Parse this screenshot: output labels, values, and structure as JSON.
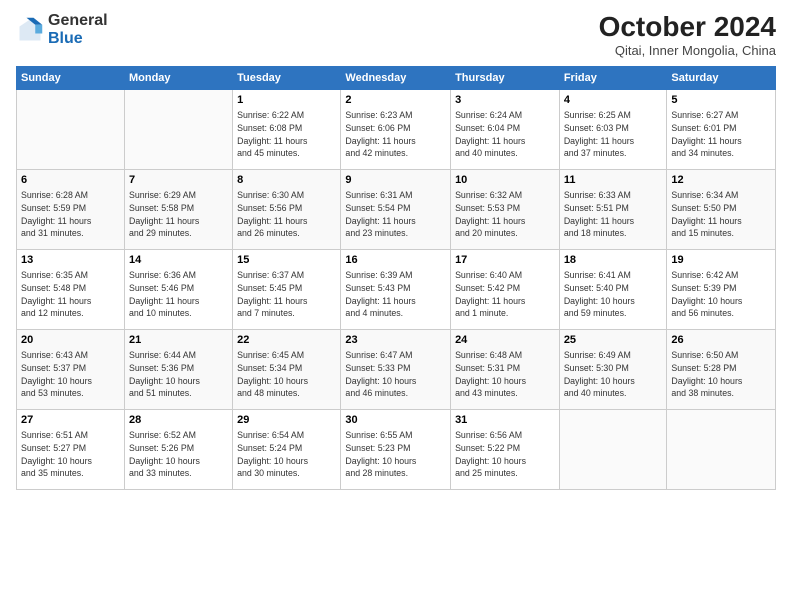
{
  "logo": {
    "general": "General",
    "blue": "Blue"
  },
  "title": "October 2024",
  "subtitle": "Qitai, Inner Mongolia, China",
  "days_header": [
    "Sunday",
    "Monday",
    "Tuesday",
    "Wednesday",
    "Thursday",
    "Friday",
    "Saturday"
  ],
  "weeks": [
    [
      {
        "day": "",
        "info": ""
      },
      {
        "day": "",
        "info": ""
      },
      {
        "day": "1",
        "info": "Sunrise: 6:22 AM\nSunset: 6:08 PM\nDaylight: 11 hours\nand 45 minutes."
      },
      {
        "day": "2",
        "info": "Sunrise: 6:23 AM\nSunset: 6:06 PM\nDaylight: 11 hours\nand 42 minutes."
      },
      {
        "day": "3",
        "info": "Sunrise: 6:24 AM\nSunset: 6:04 PM\nDaylight: 11 hours\nand 40 minutes."
      },
      {
        "day": "4",
        "info": "Sunrise: 6:25 AM\nSunset: 6:03 PM\nDaylight: 11 hours\nand 37 minutes."
      },
      {
        "day": "5",
        "info": "Sunrise: 6:27 AM\nSunset: 6:01 PM\nDaylight: 11 hours\nand 34 minutes."
      }
    ],
    [
      {
        "day": "6",
        "info": "Sunrise: 6:28 AM\nSunset: 5:59 PM\nDaylight: 11 hours\nand 31 minutes."
      },
      {
        "day": "7",
        "info": "Sunrise: 6:29 AM\nSunset: 5:58 PM\nDaylight: 11 hours\nand 29 minutes."
      },
      {
        "day": "8",
        "info": "Sunrise: 6:30 AM\nSunset: 5:56 PM\nDaylight: 11 hours\nand 26 minutes."
      },
      {
        "day": "9",
        "info": "Sunrise: 6:31 AM\nSunset: 5:54 PM\nDaylight: 11 hours\nand 23 minutes."
      },
      {
        "day": "10",
        "info": "Sunrise: 6:32 AM\nSunset: 5:53 PM\nDaylight: 11 hours\nand 20 minutes."
      },
      {
        "day": "11",
        "info": "Sunrise: 6:33 AM\nSunset: 5:51 PM\nDaylight: 11 hours\nand 18 minutes."
      },
      {
        "day": "12",
        "info": "Sunrise: 6:34 AM\nSunset: 5:50 PM\nDaylight: 11 hours\nand 15 minutes."
      }
    ],
    [
      {
        "day": "13",
        "info": "Sunrise: 6:35 AM\nSunset: 5:48 PM\nDaylight: 11 hours\nand 12 minutes."
      },
      {
        "day": "14",
        "info": "Sunrise: 6:36 AM\nSunset: 5:46 PM\nDaylight: 11 hours\nand 10 minutes."
      },
      {
        "day": "15",
        "info": "Sunrise: 6:37 AM\nSunset: 5:45 PM\nDaylight: 11 hours\nand 7 minutes."
      },
      {
        "day": "16",
        "info": "Sunrise: 6:39 AM\nSunset: 5:43 PM\nDaylight: 11 hours\nand 4 minutes."
      },
      {
        "day": "17",
        "info": "Sunrise: 6:40 AM\nSunset: 5:42 PM\nDaylight: 11 hours\nand 1 minute."
      },
      {
        "day": "18",
        "info": "Sunrise: 6:41 AM\nSunset: 5:40 PM\nDaylight: 10 hours\nand 59 minutes."
      },
      {
        "day": "19",
        "info": "Sunrise: 6:42 AM\nSunset: 5:39 PM\nDaylight: 10 hours\nand 56 minutes."
      }
    ],
    [
      {
        "day": "20",
        "info": "Sunrise: 6:43 AM\nSunset: 5:37 PM\nDaylight: 10 hours\nand 53 minutes."
      },
      {
        "day": "21",
        "info": "Sunrise: 6:44 AM\nSunset: 5:36 PM\nDaylight: 10 hours\nand 51 minutes."
      },
      {
        "day": "22",
        "info": "Sunrise: 6:45 AM\nSunset: 5:34 PM\nDaylight: 10 hours\nand 48 minutes."
      },
      {
        "day": "23",
        "info": "Sunrise: 6:47 AM\nSunset: 5:33 PM\nDaylight: 10 hours\nand 46 minutes."
      },
      {
        "day": "24",
        "info": "Sunrise: 6:48 AM\nSunset: 5:31 PM\nDaylight: 10 hours\nand 43 minutes."
      },
      {
        "day": "25",
        "info": "Sunrise: 6:49 AM\nSunset: 5:30 PM\nDaylight: 10 hours\nand 40 minutes."
      },
      {
        "day": "26",
        "info": "Sunrise: 6:50 AM\nSunset: 5:28 PM\nDaylight: 10 hours\nand 38 minutes."
      }
    ],
    [
      {
        "day": "27",
        "info": "Sunrise: 6:51 AM\nSunset: 5:27 PM\nDaylight: 10 hours\nand 35 minutes."
      },
      {
        "day": "28",
        "info": "Sunrise: 6:52 AM\nSunset: 5:26 PM\nDaylight: 10 hours\nand 33 minutes."
      },
      {
        "day": "29",
        "info": "Sunrise: 6:54 AM\nSunset: 5:24 PM\nDaylight: 10 hours\nand 30 minutes."
      },
      {
        "day": "30",
        "info": "Sunrise: 6:55 AM\nSunset: 5:23 PM\nDaylight: 10 hours\nand 28 minutes."
      },
      {
        "day": "31",
        "info": "Sunrise: 6:56 AM\nSunset: 5:22 PM\nDaylight: 10 hours\nand 25 minutes."
      },
      {
        "day": "",
        "info": ""
      },
      {
        "day": "",
        "info": ""
      }
    ]
  ]
}
